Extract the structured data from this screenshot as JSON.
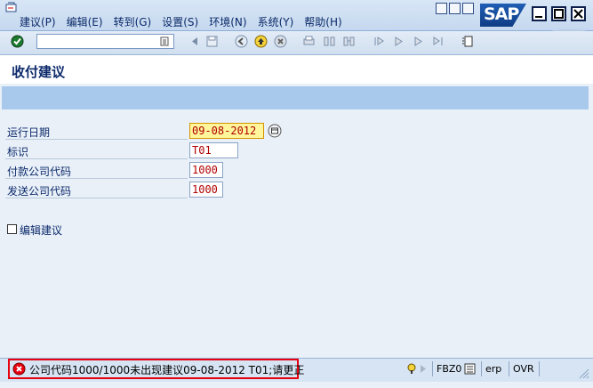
{
  "window": {
    "menu": [
      "建议(P)",
      "编辑(E)",
      "转到(G)",
      "设置(S)",
      "环境(N)",
      "系统(Y)",
      "帮助(H)"
    ],
    "logo_text": "SAP"
  },
  "title": "收付建议",
  "fields": [
    {
      "label": "运行日期",
      "value": "09-08-2012",
      "required": true
    },
    {
      "label": "标识",
      "value": "T01"
    },
    {
      "label": "付款公司代码",
      "value": "1000"
    },
    {
      "label": "发送公司代码",
      "value": "1000"
    }
  ],
  "checkbox": {
    "label": "编辑建议",
    "checked": false
  },
  "status": {
    "message": "公司代码1000/1000未出现建议09-08-2012 T01;请更正",
    "transaction": "FBZ0",
    "system": "erp",
    "mode": "OVR"
  },
  "colors": {
    "error": "#e8000f",
    "required_bg": "#fff59a",
    "value_text": "#b00000"
  }
}
